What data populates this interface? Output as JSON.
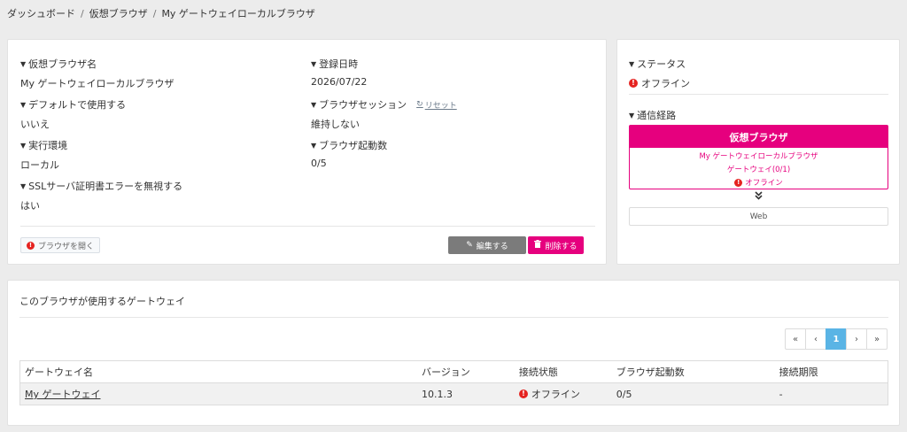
{
  "breadcrumb": [
    "ダッシュボード",
    "仮想ブラウザ",
    "My ゲートウェイローカルブラウザ"
  ],
  "detail": {
    "browser_name_label": "仮想ブラウザ名",
    "browser_name_value": "My ゲートウェイローカルブラウザ",
    "registered_label": "登録日時",
    "registered_value": "2026/07/22",
    "default_label": "デフォルトで使用する",
    "default_value": "いいえ",
    "session_label": "ブラウザセッション",
    "reset_label": "リセット",
    "session_value": "維持しない",
    "env_label": "実行環境",
    "env_value": "ローカル",
    "launch_count_label": "ブラウザ起動数",
    "launch_count_value": "0/5",
    "ssl_label": "SSLサーバ証明書エラーを無視する",
    "ssl_value": "はい",
    "open_button": "ブラウザを開く",
    "edit_button": "編集する",
    "delete_button": "削除する"
  },
  "side": {
    "status_label": "ステータス",
    "status_value": "オフライン",
    "route_label": "通信経路",
    "route_head": "仮想ブラウザ",
    "route_browser": "My ゲートウェイローカルブラウザ",
    "route_gateway": "ゲートウェイ(0/1)",
    "route_status": "オフライン",
    "web_label": "Web"
  },
  "gateways": {
    "title": "このブラウザが使用するゲートウェイ",
    "pager": {
      "first": "«",
      "prev": "‹",
      "current": "1",
      "next": "›",
      "last": "»"
    },
    "columns": [
      "ゲートウェイ名",
      "バージョン",
      "接続状態",
      "ブラウザ起動数",
      "接続期限"
    ],
    "rows": [
      {
        "name": "My ゲートウェイ",
        "version": "10.1.3",
        "status": "オフライン",
        "launch": "0/5",
        "limit": "-"
      }
    ]
  },
  "colors": {
    "accent": "#e6007e",
    "error": "#e52320",
    "pager_active": "#5ab4e5"
  }
}
